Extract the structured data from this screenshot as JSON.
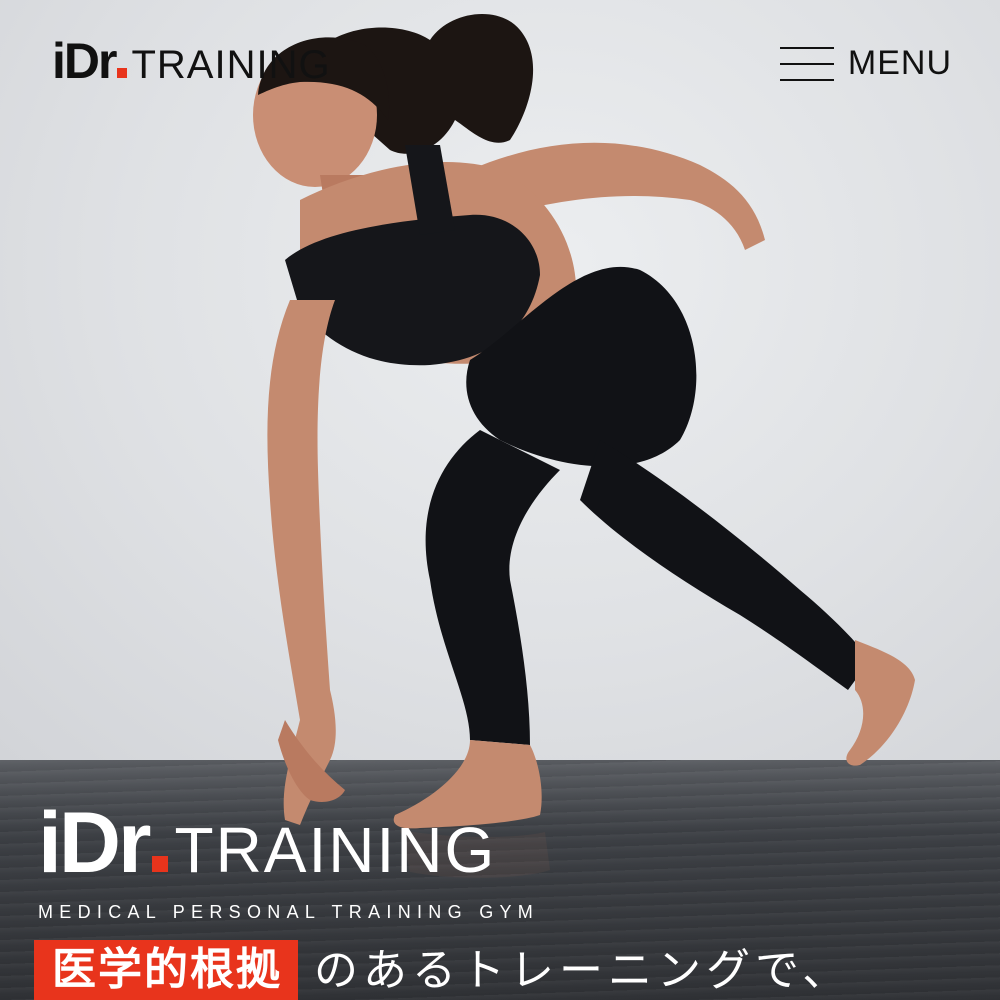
{
  "header": {
    "logo_mark": "iDr",
    "logo_word": "TRAINING",
    "menu_label": "MENU"
  },
  "hero": {
    "brand_mark": "iDr",
    "brand_word": "TRAINING",
    "tagline": "MEDICAL PERSONAL TRAINING GYM",
    "catch_highlight": "医学的根拠",
    "catch_rest": "のあるトレーニングで、"
  },
  "colors": {
    "accent": "#e8341c",
    "ink": "#111111",
    "wall": "#dfe1e4",
    "floor": "#35383c"
  },
  "icons": {
    "menu": "hamburger-icon"
  }
}
